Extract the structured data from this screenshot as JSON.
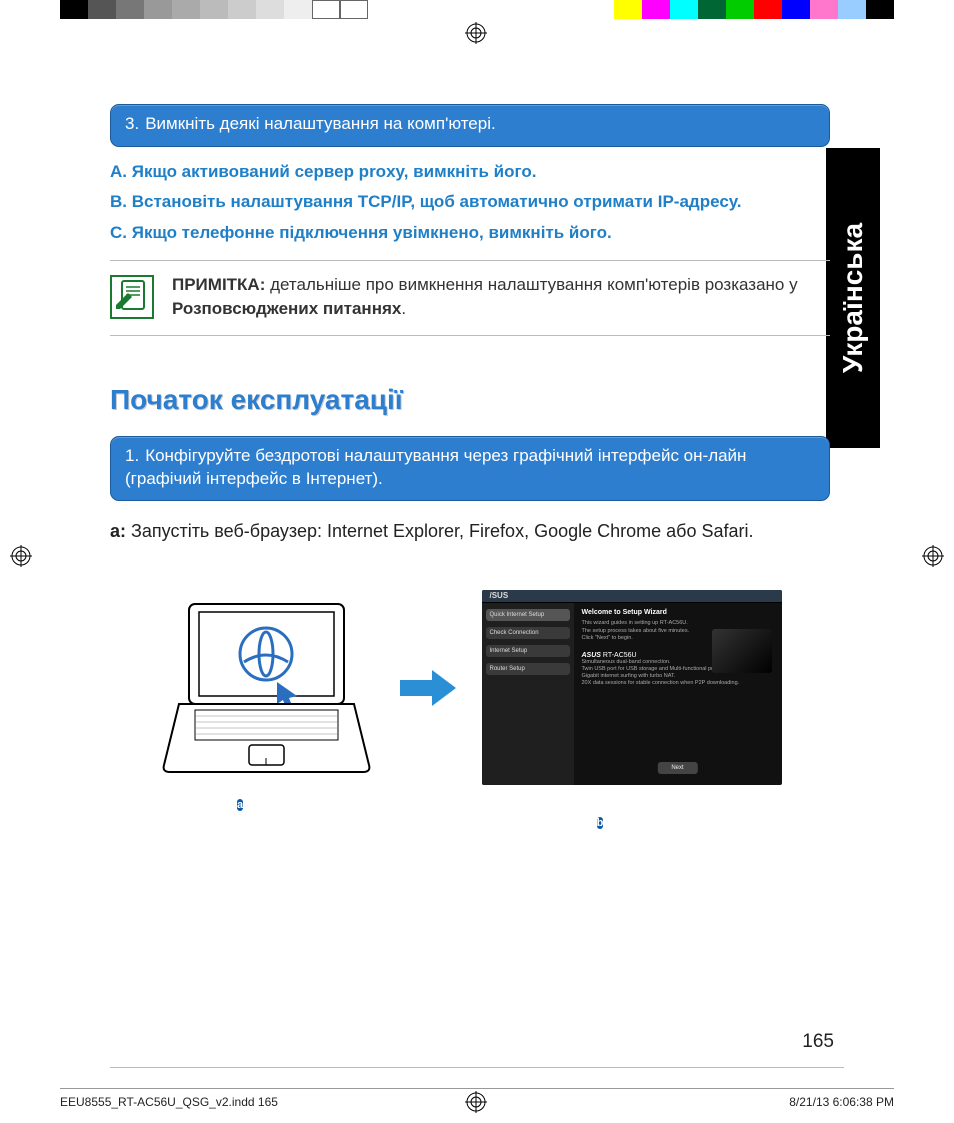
{
  "box3": {
    "num": "3.",
    "text": "Вимкніть деякі налаштування на комп'ютері."
  },
  "sub": {
    "a": "A.   Якщо активований сервер proxy, вимкніть його.",
    "b": "B.   Встановіть налаштування TCP/IP, щоб автоматично отримати IP-адресу.",
    "c": "C. Якщо телефонне підключення увімкнено, вимкніть його."
  },
  "note": {
    "label": "ПРИМІТКА:",
    "text": "  детальніше про вимкнення налаштування комп'ютерів розказано у ",
    "bold": "Розповсюджених питаннях",
    "tail": "."
  },
  "section_title": "Початок експлуатації",
  "box1": {
    "num": "1.",
    "text": "Конфігуруйте бездротові налаштування через графічний інтерфейс он-лайн (графічий інтерфейс в Інтернет)."
  },
  "step_a": {
    "label": "a:",
    "text": "  Запустіть веб-браузер: Internet Explorer, Firefox, Google Chrome або  Safari."
  },
  "wizard": {
    "brand": "/SUS",
    "side": [
      "Quick Internet Setup",
      "Check Connection",
      "Internet Setup",
      "Router Setup"
    ],
    "title": "Welcome to Setup Wizard",
    "line1": "This wizard guides in setting up RT-AC56U.",
    "line2": "The setup process takes about five minutes.",
    "line3": "Click \"Next\" to begin.",
    "model_brand": "ASUS",
    "model": " RT-AC56U",
    "feat1": "Simultaneous dual-band connection.",
    "feat2": "Twin USB port for USB storage and Multi-functional printer.",
    "feat3": "Gigabit internet surfing with turbo NAT.",
    "feat4": "20X data sessions for stable connection when P2P downloading.",
    "next": "Next"
  },
  "caption_a": "a",
  "caption_b": "b",
  "language_tab": "Українська",
  "page_number": "165",
  "footer_left": "EEU8555_RT-AC56U_QSG_v2.indd   165",
  "footer_right": "8/21/13   6:06:38 PM"
}
